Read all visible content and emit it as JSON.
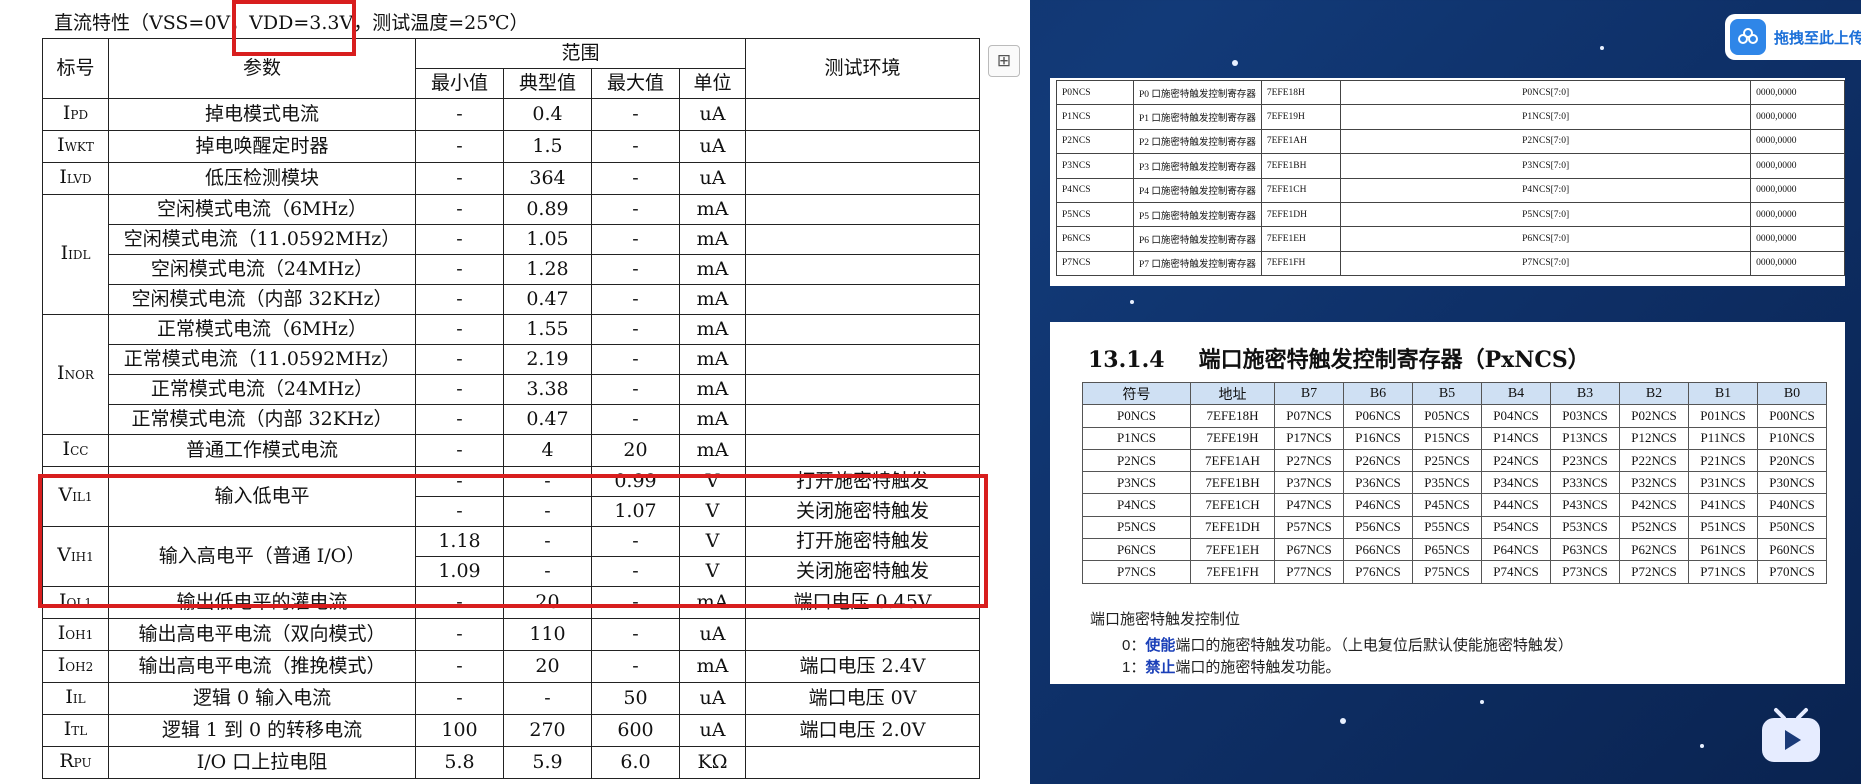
{
  "left_doc": {
    "title": "直流特性（VSS=0V，VDD=3.3V，测试温度=25℃）",
    "header": {
      "symbol": "标号",
      "param": "参数",
      "range": "范围",
      "min": "最小值",
      "typ": "典型值",
      "max": "最大值",
      "unit": "单位",
      "env": "测试环境"
    },
    "rows": [
      {
        "sym": "I",
        "sub": "PD",
        "param": "掉电模式电流",
        "min": "-",
        "typ": "0.4",
        "max": "-",
        "unit": "uA",
        "env": ""
      },
      {
        "sym": "I",
        "sub": "WKT",
        "param": "掉电唤醒定时器",
        "min": "-",
        "typ": "1.5",
        "max": "-",
        "unit": "uA",
        "env": ""
      },
      {
        "sym": "I",
        "sub": "LVD",
        "param": "低压检测模块",
        "min": "-",
        "typ": "364",
        "max": "-",
        "unit": "uA",
        "env": ""
      },
      {
        "sym": "I",
        "sub": "IDL",
        "param": "空闲模式电流（6MHz）",
        "min": "-",
        "typ": "0.89",
        "max": "-",
        "unit": "mA",
        "env": ""
      },
      {
        "sym": "",
        "sub": "",
        "param": "空闲模式电流（11.0592MHz）",
        "min": "-",
        "typ": "1.05",
        "max": "-",
        "unit": "mA",
        "env": ""
      },
      {
        "sym": "",
        "sub": "",
        "param": "空闲模式电流（24MHz）",
        "min": "-",
        "typ": "1.28",
        "max": "-",
        "unit": "mA",
        "env": ""
      },
      {
        "sym": "",
        "sub": "",
        "param": "空闲模式电流（内部 32KHz）",
        "min": "-",
        "typ": "0.47",
        "max": "-",
        "unit": "mA",
        "env": ""
      },
      {
        "sym": "I",
        "sub": "NOR",
        "param": "正常模式电流（6MHz）",
        "min": "-",
        "typ": "1.55",
        "max": "-",
        "unit": "mA",
        "env": ""
      },
      {
        "sym": "",
        "sub": "",
        "param": "正常模式电流（11.0592MHz）",
        "min": "-",
        "typ": "2.19",
        "max": "-",
        "unit": "mA",
        "env": ""
      },
      {
        "sym": "",
        "sub": "",
        "param": "正常模式电流（24MHz）",
        "min": "-",
        "typ": "3.38",
        "max": "-",
        "unit": "mA",
        "env": ""
      },
      {
        "sym": "",
        "sub": "",
        "param": "正常模式电流（内部 32KHz）",
        "min": "-",
        "typ": "0.47",
        "max": "-",
        "unit": "mA",
        "env": ""
      },
      {
        "sym": "I",
        "sub": "CC",
        "param": "普通工作模式电流",
        "min": "-",
        "typ": "4",
        "max": "20",
        "unit": "mA",
        "env": ""
      },
      {
        "sym": "V",
        "sub": "IL1",
        "param": "输入低电平",
        "min": "-",
        "typ": "-",
        "max": "0.99",
        "unit": "V",
        "env": "打开施密特触发"
      },
      {
        "sym": "",
        "sub": "",
        "param": "",
        "min": "-",
        "typ": "-",
        "max": "1.07",
        "unit": "V",
        "env": "关闭施密特触发"
      },
      {
        "sym": "V",
        "sub": "IH1",
        "param": "输入高电平（普通 I/O）",
        "min": "1.18",
        "typ": "-",
        "max": "-",
        "unit": "V",
        "env": "打开施密特触发"
      },
      {
        "sym": "",
        "sub": "",
        "param": "",
        "min": "1.09",
        "typ": "-",
        "max": "-",
        "unit": "V",
        "env": "关闭施密特触发"
      },
      {
        "sym": "I",
        "sub": "OL1",
        "param": "输出低电平的灌电流",
        "min": "-",
        "typ": "20",
        "max": "-",
        "unit": "mA",
        "env": "端口电压 0.45V"
      },
      {
        "sym": "I",
        "sub": "OH1",
        "param": "输出高电平电流（双向模式）",
        "min": "-",
        "typ": "110",
        "max": "-",
        "unit": "uA",
        "env": ""
      },
      {
        "sym": "I",
        "sub": "OH2",
        "param": "输出高电平电流（推挽模式）",
        "min": "-",
        "typ": "20",
        "max": "-",
        "unit": "mA",
        "env": "端口电压 2.4V"
      },
      {
        "sym": "I",
        "sub": "IL",
        "param": "逻辑 0 输入电流",
        "min": "-",
        "typ": "-",
        "max": "50",
        "unit": "uA",
        "env": "端口电压 0V"
      },
      {
        "sym": "I",
        "sub": "TL",
        "param": "逻辑 1 到 0 的转移电流",
        "min": "100",
        "typ": "270",
        "max": "600",
        "unit": "uA",
        "env": "端口电压 2.0V"
      },
      {
        "sym": "R",
        "sub": "PU",
        "param": "I/O 口上拉电阻",
        "min": "5.8",
        "typ": "5.9",
        "max": "6.0",
        "unit": "KΩ",
        "env": ""
      }
    ]
  },
  "reg_doc": {
    "rows": [
      {
        "name": "P0NCS",
        "desc": "P0 口施密特触发控制寄存器",
        "addr": "7EFE18H",
        "bits": "P0NCS[7:0]",
        "reset": "0000,0000"
      },
      {
        "name": "P1NCS",
        "desc": "P1 口施密特触发控制寄存器",
        "addr": "7EFE19H",
        "bits": "P1NCS[7:0]",
        "reset": "0000,0000"
      },
      {
        "name": "P2NCS",
        "desc": "P2 口施密特触发控制寄存器",
        "addr": "7EFE1AH",
        "bits": "P2NCS[7:0]",
        "reset": "0000,0000"
      },
      {
        "name": "P3NCS",
        "desc": "P3 口施密特触发控制寄存器",
        "addr": "7EFE1BH",
        "bits": "P3NCS[7:0]",
        "reset": "0000,0000"
      },
      {
        "name": "P4NCS",
        "desc": "P4 口施密特触发控制寄存器",
        "addr": "7EFE1CH",
        "bits": "P4NCS[7:0]",
        "reset": "0000,0000"
      },
      {
        "name": "P5NCS",
        "desc": "P5 口施密特触发控制寄存器",
        "addr": "7EFE1DH",
        "bits": "P5NCS[7:0]",
        "reset": "0000,0000"
      },
      {
        "name": "P6NCS",
        "desc": "P6 口施密特触发控制寄存器",
        "addr": "7EFE1EH",
        "bits": "P6NCS[7:0]",
        "reset": "0000,0000"
      },
      {
        "name": "P7NCS",
        "desc": "P7 口施密特触发控制寄存器",
        "addr": "7EFE1FH",
        "bits": "P7NCS[7:0]",
        "reset": "0000,0000"
      }
    ]
  },
  "ncs_doc": {
    "section_number": "13.1.4",
    "section_title": "端口施密特触发控制寄存器（PxNCS）",
    "header": [
      "符号",
      "地址",
      "B7",
      "B6",
      "B5",
      "B4",
      "B3",
      "B2",
      "B1",
      "B0"
    ],
    "rows": [
      [
        "P0NCS",
        "7EFE18H",
        "P07NCS",
        "P06NCS",
        "P05NCS",
        "P04NCS",
        "P03NCS",
        "P02NCS",
        "P01NCS",
        "P00NCS"
      ],
      [
        "P1NCS",
        "7EFE19H",
        "P17NCS",
        "P16NCS",
        "P15NCS",
        "P14NCS",
        "P13NCS",
        "P12NCS",
        "P11NCS",
        "P10NCS"
      ],
      [
        "P2NCS",
        "7EFE1AH",
        "P27NCS",
        "P26NCS",
        "P25NCS",
        "P24NCS",
        "P23NCS",
        "P22NCS",
        "P21NCS",
        "P20NCS"
      ],
      [
        "P3NCS",
        "7EFE1BH",
        "P37NCS",
        "P36NCS",
        "P35NCS",
        "P34NCS",
        "P33NCS",
        "P32NCS",
        "P31NCS",
        "P30NCS"
      ],
      [
        "P4NCS",
        "7EFE1CH",
        "P47NCS",
        "P46NCS",
        "P45NCS",
        "P44NCS",
        "P43NCS",
        "P42NCS",
        "P41NCS",
        "P40NCS"
      ],
      [
        "P5NCS",
        "7EFE1DH",
        "P57NCS",
        "P56NCS",
        "P55NCS",
        "P54NCS",
        "P53NCS",
        "P52NCS",
        "P51NCS",
        "P50NCS"
      ],
      [
        "P6NCS",
        "7EFE1EH",
        "P67NCS",
        "P66NCS",
        "P65NCS",
        "P64NCS",
        "P63NCS",
        "P62NCS",
        "P61NCS",
        "P60NCS"
      ],
      [
        "P7NCS",
        "7EFE1FH",
        "P77NCS",
        "P76NCS",
        "P75NCS",
        "P74NCS",
        "P73NCS",
        "P72NCS",
        "P71NCS",
        "P70NCS"
      ]
    ],
    "caption": "端口施密特触发控制位",
    "bit0_prefix": "0：",
    "bit0_kw": "使能",
    "bit0_rest": "端口的施密特触发功能。（上电复位后默认使能施密特触发）",
    "bit1_prefix": "1：",
    "bit1_kw": "禁止",
    "bit1_rest": "端口的施密特触发功能。"
  },
  "cloud_button": {
    "label": "拖拽至此上传",
    "icon": "cloud-share-icon"
  },
  "player_icon": "bilibili-tv-icon",
  "colors": {
    "highlight_red": "#d81e1e",
    "table_header_blue": "#cfe0f3",
    "keyword_blue": "#1a3fb8",
    "background_navy": "#123a78"
  }
}
